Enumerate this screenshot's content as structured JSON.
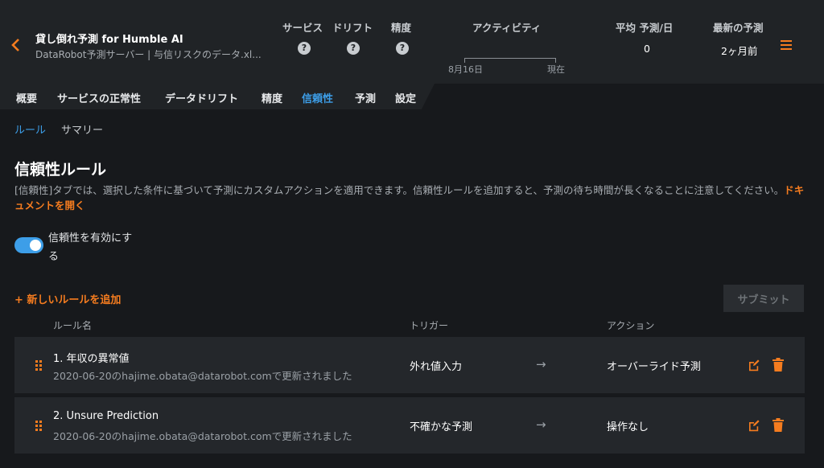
{
  "header": {
    "title": "貸し倒れ予測 for Humble AI",
    "subtitle": "DataRobot予測サーバー | 与信リスクのデータ.xl...",
    "columns": {
      "service": "サービス",
      "drift": "ドリフト",
      "accuracy": "精度",
      "activity": "アクティビティ",
      "avg_predictions": "平均 予測/日",
      "latest_prediction": "最新の予測"
    },
    "help_glyph": "?",
    "timeline": {
      "start_label": "8月16日",
      "end_label": "現在"
    },
    "avg_predictions_value": "0",
    "latest_prediction_value": "2ヶ月前"
  },
  "tabs": [
    "概要",
    "サービスの正常性",
    "データドリフト",
    "精度",
    "信頼性",
    "予測",
    "設定"
  ],
  "active_tab": "信頼性",
  "subnav": {
    "rules": "ルール",
    "summary": "サマリー"
  },
  "page": {
    "heading": "信頼性ルール",
    "description": "[信頼性]タブでは、選択した条件に基づいて予測にカスタムアクションを適用できます。信頼性ルールを追加すると、予測の待ち時間が長くなることに注意してください。",
    "doc_link": "ドキュメントを開く",
    "toggle_label": "信頼性を有効にする",
    "toggle_on": true,
    "add_rule": "+ 新しいルールを追加",
    "submit": "サブミット"
  },
  "table": {
    "headers": {
      "name": "ルール名",
      "trigger": "トリガー",
      "action": "アクション"
    },
    "rows": [
      {
        "name": "1. 年収の異常値",
        "meta": "2020-06-20のhajime.obata@datarobot.comで更新されました",
        "trigger": "外れ値入力",
        "arrow": "→",
        "action": "オーバーライド予測"
      },
      {
        "name": "2. Unsure Prediction",
        "meta": "2020-06-20のhajime.obata@datarobot.comで更新されました",
        "trigger": "不確かな予測",
        "arrow": "→",
        "action": "操作なし"
      }
    ]
  },
  "colors": {
    "accent_orange": "#f57c1f",
    "accent_blue": "#3d9ee8",
    "background": "#17191c",
    "header_bg": "#202326",
    "row_bg": "#24272b"
  },
  "icons": {
    "back": "chevron-left-icon",
    "help": "question-circle-icon",
    "menu": "hamburger-menu-icon",
    "drag": "drag-handle-icon",
    "edit": "edit-icon",
    "delete": "trash-icon"
  }
}
